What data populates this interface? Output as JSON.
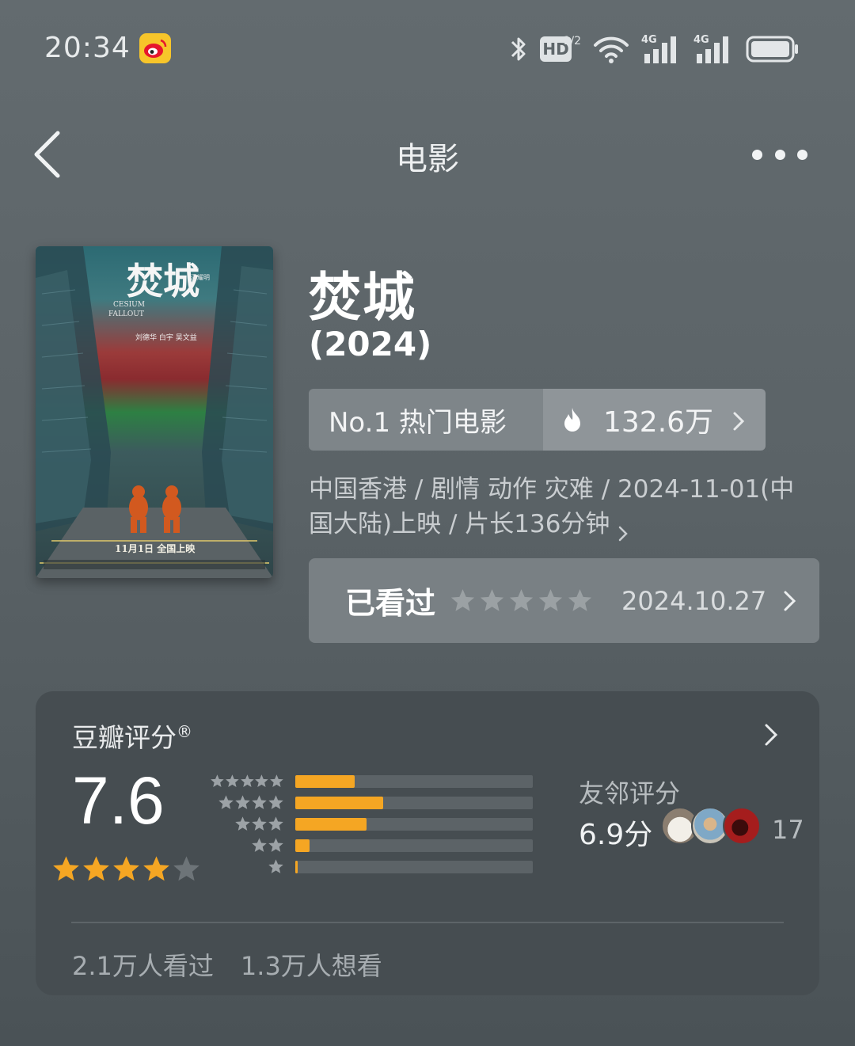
{
  "status_bar": {
    "time": "20:34",
    "app_icon": "weibo-icon",
    "icons": [
      "bluetooth-icon",
      "hd-voice-icon",
      "wifi-icon",
      "signal-4g-icon",
      "signal-4g-icon",
      "battery-icon"
    ],
    "hd_text": "HD",
    "hd_sub": "1/2",
    "network_label": "4G"
  },
  "nav": {
    "back_icon": "chevron-left-icon",
    "title": "电影",
    "more_icon": "more-dots-icon"
  },
  "movie": {
    "title": "焚城",
    "year": "(2024)",
    "rank_label": "No.1 热门电影",
    "heat_icon": "flame-icon",
    "heat_value": "132.6万",
    "meta": "中国香港 / 剧情 动作 灾难 / 2024-11-01(中国大陆)上映 / 片长136分钟",
    "poster": {
      "title_cn": "焚城",
      "title_en_1": "CESIUM",
      "title_en_2": "FALLOUT",
      "director": "潘耀明",
      "cast": "刘德华 白宇 吴文益",
      "release": "11月1日 全国上映"
    }
  },
  "watched": {
    "label": "已看过",
    "user_rating": 0,
    "date": "2024.10.27"
  },
  "rating": {
    "header": "豆瓣评分",
    "registered_mark": "®",
    "score": "7.6",
    "stars": 4,
    "distribution": [
      0.25,
      0.37,
      0.3,
      0.06,
      0.01
    ],
    "friends_label": "友邻评分",
    "friends_score": "6.9分",
    "friends_count": "17",
    "watched_count": "2.1万人看过",
    "wish_count": "1.3万人想看"
  },
  "colors": {
    "accent_star": "#f5a623",
    "background": "#5f676b",
    "card": "#464d51"
  }
}
